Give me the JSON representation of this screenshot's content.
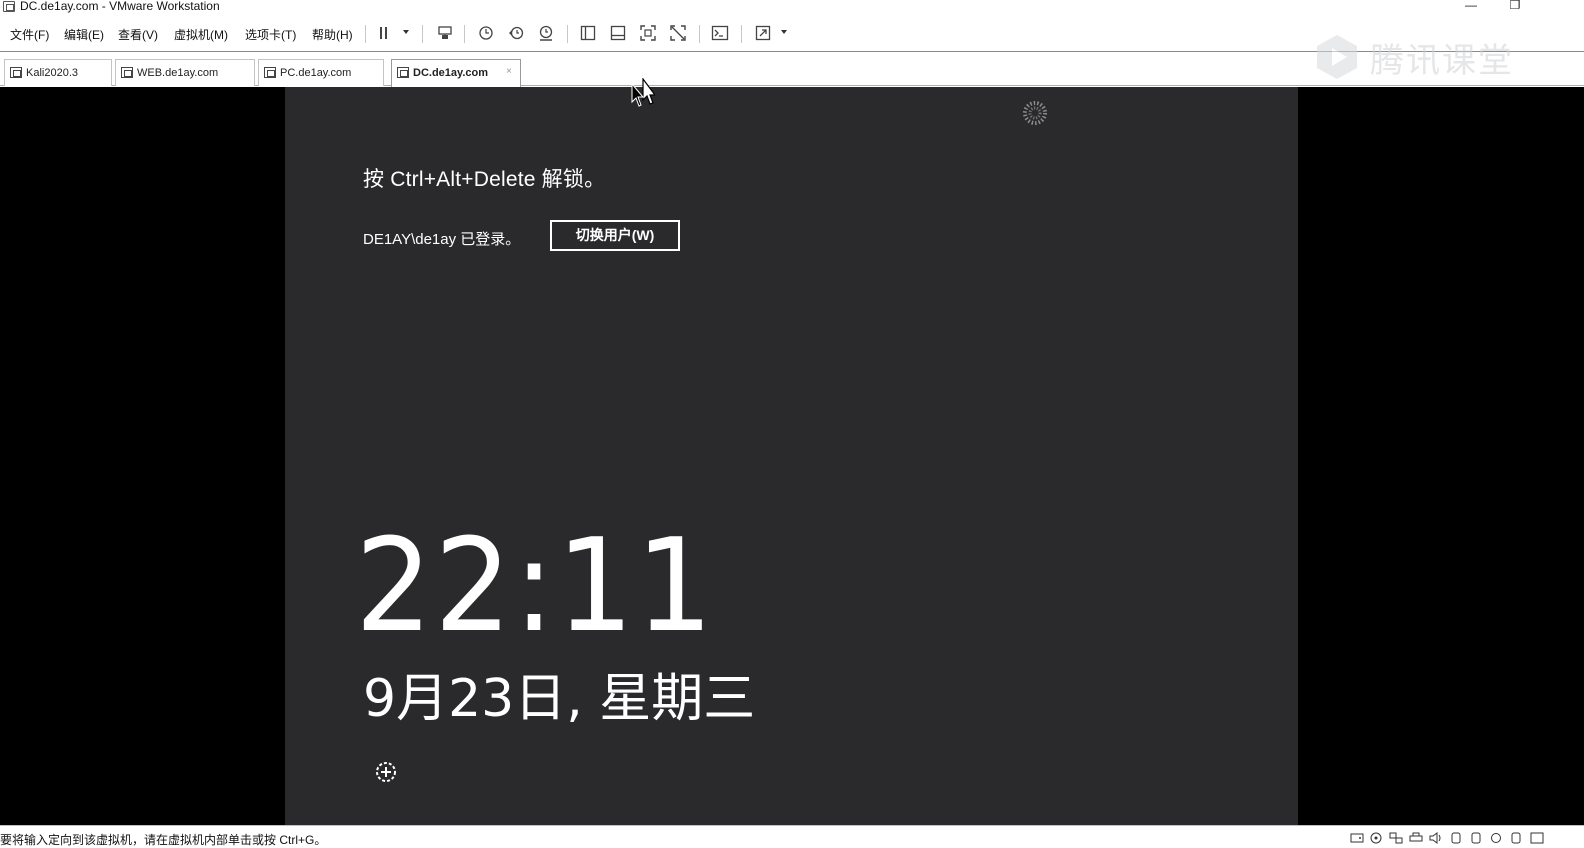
{
  "window": {
    "title": "DC.de1ay.com - VMware Workstation",
    "minimize_glyph": "—",
    "restore_glyph": "❐"
  },
  "menu": [
    {
      "label": "文件(F)"
    },
    {
      "label": "编辑(E)"
    },
    {
      "label": "查看(V)"
    },
    {
      "label": "虚拟机(M)"
    },
    {
      "label": "选项卡(T)"
    },
    {
      "label": "帮助(H)"
    }
  ],
  "toolbar": {
    "icons": [
      "pause-icon",
      "send-ctrl-alt-del-icon",
      "snapshot-icon",
      "revert-snapshot-icon",
      "snapshot-manager-icon",
      "library-view-icon",
      "thumbnail-view-icon",
      "fullscreen-icon",
      "unity-icon",
      "console-icon",
      "stretch-icon"
    ]
  },
  "tabs": [
    {
      "label": "Kali2020.3",
      "active": false
    },
    {
      "label": "WEB.de1ay.com",
      "active": false
    },
    {
      "label": "PC.de1ay.com",
      "active": false
    },
    {
      "label": "DC.de1ay.com",
      "active": true
    }
  ],
  "tab_close_glyph": "×",
  "watermark": {
    "text": "腾讯课堂"
  },
  "lock_screen": {
    "unlock_hint": "按 Ctrl+Alt+Delete 解锁。",
    "login_status": "DE1AY\\de1ay 已登录。",
    "switch_user_label": "切换用户(W)",
    "time": "22:11",
    "date": "9月23日, 星期三"
  },
  "statusbar": {
    "message": "要将输入定向到该虚拟机，请在虚拟机内部单击或按 Ctrl+G。",
    "devices": [
      "hard-disk-icon",
      "cd-rom-icon",
      "network-icon",
      "printer-icon",
      "sound-icon",
      "usb-icon",
      "usb-icon",
      "usb-icon",
      "display-icon"
    ]
  },
  "colors": {
    "lock_screen_bg": "#2a2a2c",
    "vm_letterbox": "#000000",
    "lock_text": "#ffffff"
  }
}
